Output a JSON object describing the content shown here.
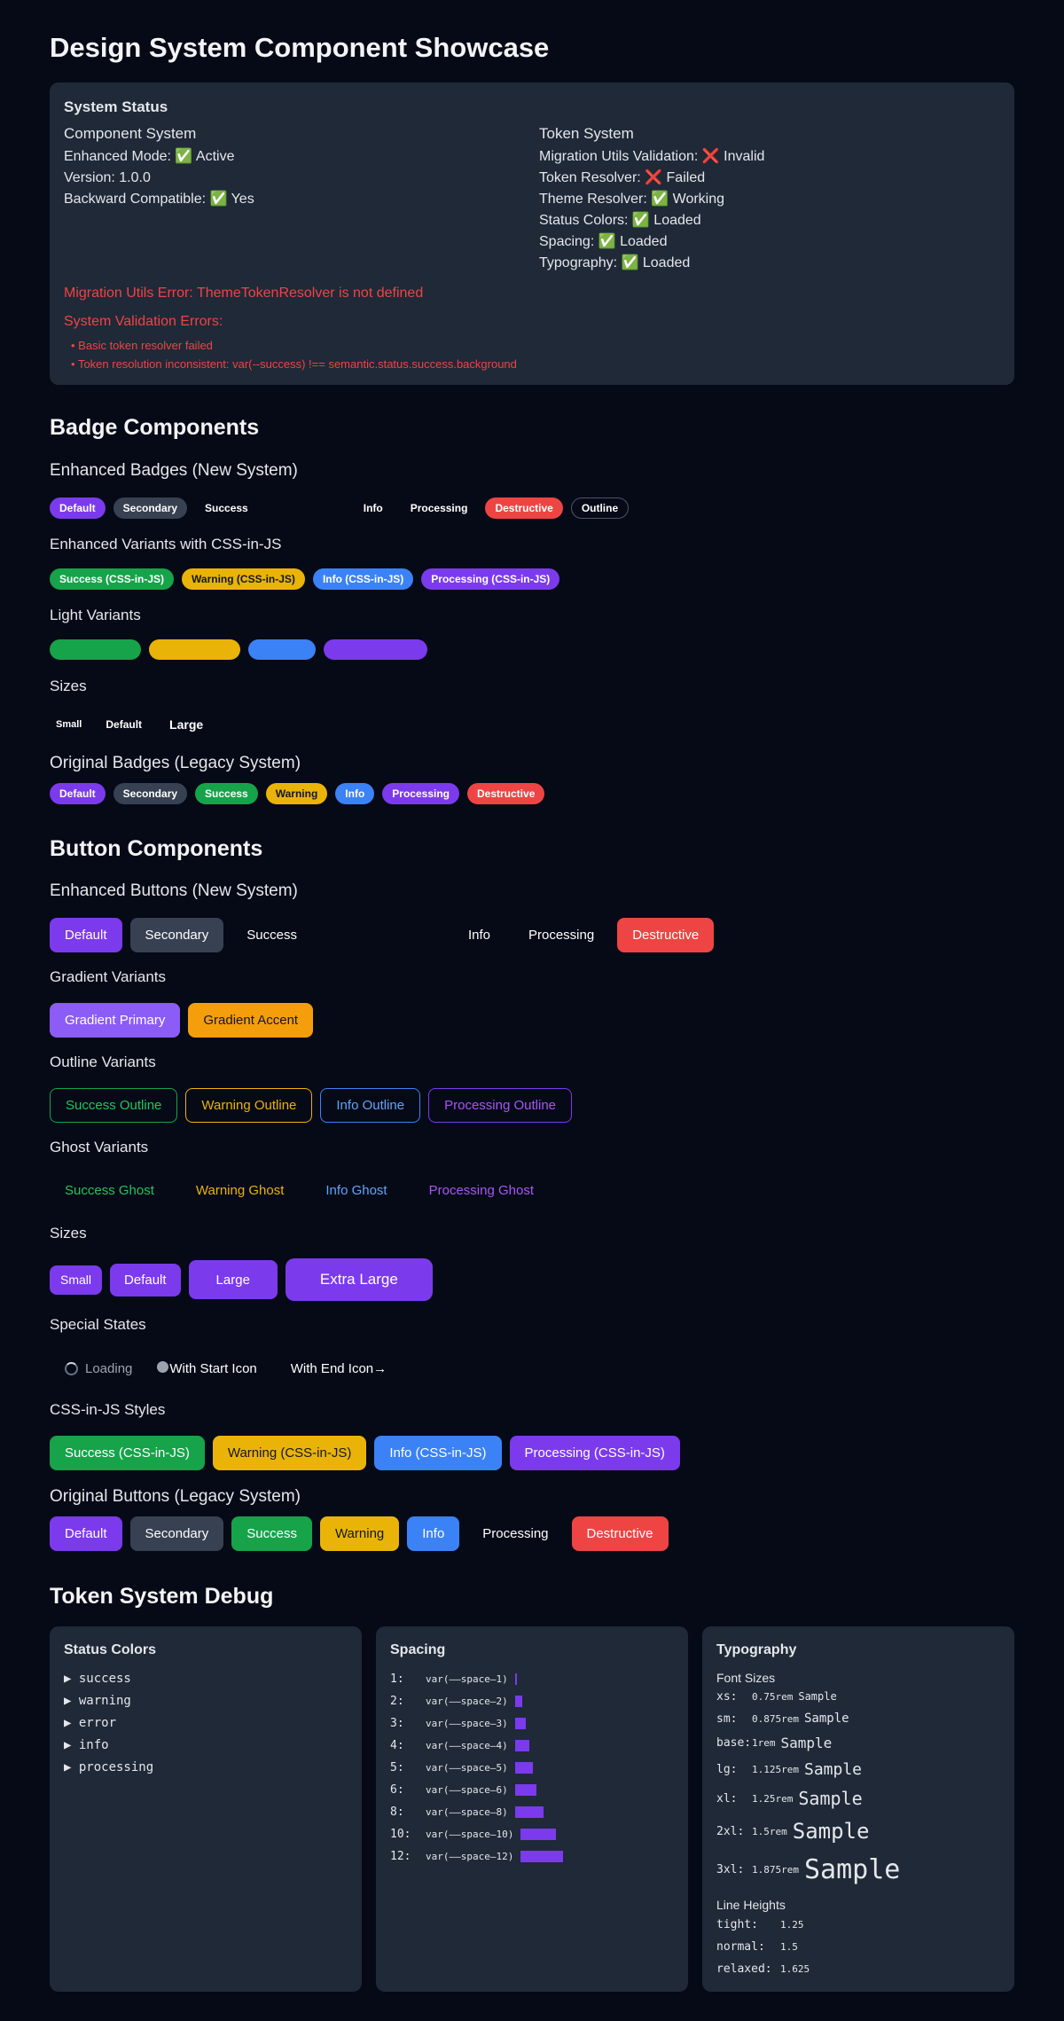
{
  "title": "Design System Component Showcase",
  "status": {
    "heading": "System Status",
    "component": {
      "heading": "Component System",
      "lines": [
        "Enhanced Mode: ✅ Active",
        "Version: 1.0.0",
        "Backward Compatible: ✅ Yes"
      ]
    },
    "token": {
      "heading": "Token System",
      "lines": [
        "Migration Utils Validation: ❌ Invalid",
        "Token Resolver: ❌ Failed",
        "Theme Resolver: ✅ Working",
        "Status Colors: ✅ Loaded",
        "Spacing: ✅ Loaded",
        "Typography: ✅ Loaded"
      ]
    },
    "migration_error": "Migration Utils Error: ThemeTokenResolver is not defined",
    "validation_heading": "System Validation Errors:",
    "validation_errors": [
      "Basic token resolver failed",
      "Token resolution inconsistent: var(--success) !== semantic.status.success.background"
    ]
  },
  "badges": {
    "heading": "Badge Components",
    "enhanced_heading": "Enhanced Badges (New System)",
    "enhanced": [
      "Default",
      "Secondary",
      "Success",
      "Info",
      "Processing",
      "Destructive",
      "Outline"
    ],
    "cssjs_heading": "Enhanced Variants with CSS-in-JS",
    "cssjs": [
      "Success (CSS-in-JS)",
      "Warning (CSS-in-JS)",
      "Info (CSS-in-JS)",
      "Processing (CSS-in-JS)"
    ],
    "light_heading": "Light Variants",
    "sizes_heading": "Sizes",
    "sizes": [
      "Small",
      "Default",
      "Large"
    ],
    "legacy_heading": "Original Badges (Legacy System)",
    "legacy": [
      "Default",
      "Secondary",
      "Success",
      "Warning",
      "Info",
      "Processing",
      "Destructive"
    ]
  },
  "buttons": {
    "heading": "Button Components",
    "enhanced_heading": "Enhanced Buttons (New System)",
    "enhanced": [
      "Default",
      "Secondary",
      "Success",
      "Info",
      "Processing",
      "Destructive"
    ],
    "gradient_heading": "Gradient Variants",
    "gradient": [
      "Gradient Primary",
      "Gradient Accent"
    ],
    "outline_heading": "Outline Variants",
    "outline": [
      "Success Outline",
      "Warning Outline",
      "Info Outline",
      "Processing Outline"
    ],
    "ghost_heading": "Ghost Variants",
    "ghost": [
      "Success Ghost",
      "Warning Ghost",
      "Info Ghost",
      "Processing Ghost"
    ],
    "sizes_heading": "Sizes",
    "sizes": [
      "Small",
      "Default",
      "Large",
      "Extra Large"
    ],
    "special_heading": "Special States",
    "special": [
      "Loading",
      "With Start Icon",
      "With End Icon→"
    ],
    "cssjs_heading": "CSS-in-JS Styles",
    "cssjs": [
      "Success (CSS-in-JS)",
      "Warning (CSS-in-JS)",
      "Info (CSS-in-JS)",
      "Processing (CSS-in-JS)"
    ],
    "legacy_heading": "Original Buttons (Legacy System)",
    "legacy": [
      "Default",
      "Secondary",
      "Success",
      "Warning",
      "Info",
      "Processing",
      "Destructive"
    ]
  },
  "debug": {
    "heading": "Token System Debug",
    "status_colors": {
      "heading": "Status Colors",
      "items": [
        "success",
        "warning",
        "error",
        "info",
        "processing"
      ]
    },
    "spacing": {
      "heading": "Spacing",
      "rows": [
        {
          "key": "1:",
          "var": "var(––space–1)",
          "rel": 1
        },
        {
          "key": "2:",
          "var": "var(––space–2)",
          "rel": 2
        },
        {
          "key": "3:",
          "var": "var(––space–3)",
          "rel": 3
        },
        {
          "key": "4:",
          "var": "var(––space–4)",
          "rel": 4
        },
        {
          "key": "5:",
          "var": "var(––space–5)",
          "rel": 5
        },
        {
          "key": "6:",
          "var": "var(––space–6)",
          "rel": 6
        },
        {
          "key": "8:",
          "var": "var(––space–8)",
          "rel": 8
        },
        {
          "key": "10:",
          "var": "var(––space–10)",
          "rel": 10
        },
        {
          "key": "12:",
          "var": "var(––space–12)",
          "rel": 12
        }
      ]
    },
    "typography": {
      "heading": "Typography",
      "font_sizes_heading": "Font Sizes",
      "font_sizes": [
        {
          "key": "xs:",
          "value": "0.75rem",
          "sample": "Sample"
        },
        {
          "key": "sm:",
          "value": "0.875rem",
          "sample": "Sample"
        },
        {
          "key": "base:",
          "value": "1rem",
          "sample": "Sample"
        },
        {
          "key": "lg:",
          "value": "1.125rem",
          "sample": "Sample"
        },
        {
          "key": "xl:",
          "value": "1.25rem",
          "sample": "Sample"
        },
        {
          "key": "2xl:",
          "value": "1.5rem",
          "sample": "Sample"
        },
        {
          "key": "3xl:",
          "value": "1.875rem",
          "sample": "Sample"
        }
      ],
      "line_heights_heading": "Line Heights",
      "line_heights": [
        {
          "key": "tight:",
          "value": "1.25"
        },
        {
          "key": "normal:",
          "value": "1.5"
        },
        {
          "key": "relaxed:",
          "value": "1.625"
        }
      ]
    }
  },
  "colors": {
    "background": "#060a16",
    "card": "#1f2937",
    "primary": "#7c3aed",
    "success": "#16a34a",
    "warning": "#eab308",
    "info": "#3b82f6",
    "destructive": "#ef4444"
  }
}
